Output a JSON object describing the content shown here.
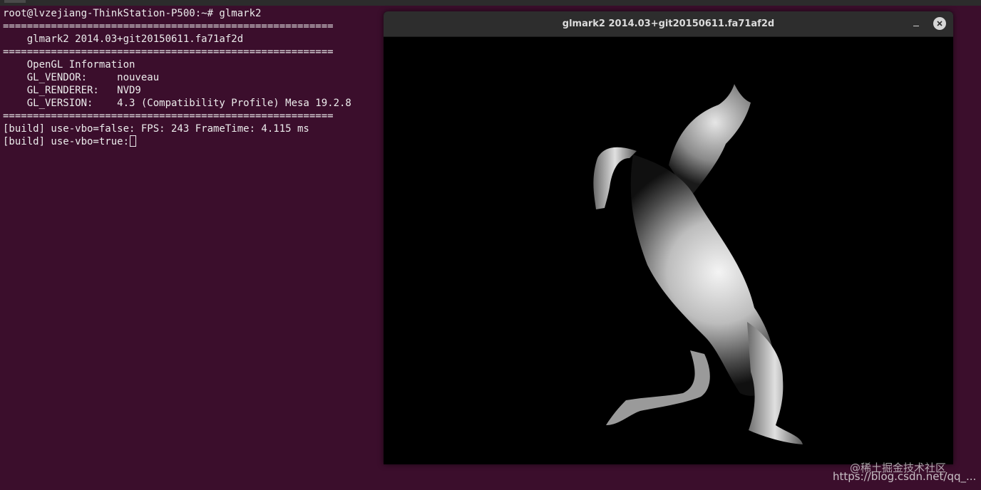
{
  "terminal": {
    "lines": [
      "root@lvzejiang-ThinkStation-P500:~# glmark2",
      "=======================================================",
      "    glmark2 2014.03+git20150611.fa71af2d",
      "=======================================================",
      "    OpenGL Information",
      "    GL_VENDOR:     nouveau",
      "    GL_RENDERER:   NVD9",
      "    GL_VERSION:    4.3 (Compatibility Profile) Mesa 19.2.8",
      "=======================================================",
      "[build] use-vbo=false: FPS: 243 FrameTime: 4.115 ms",
      "[build] use-vbo=true:"
    ]
  },
  "gl_window": {
    "title": "glmark2 2014.03+git20150611.fa71af2d",
    "scene": "horse-model"
  },
  "icons": {
    "minimize": "minimize-icon",
    "close": "close-icon"
  },
  "colors": {
    "terminal_background": "#3b0e2c",
    "terminal_text": "#ececec",
    "gl_background": "#000000",
    "titlebar": "#2d2d2d"
  },
  "watermarks": {
    "juejin": "@稀土掘金技术社区",
    "csdn": "https://blog.csdn.net/qq_..."
  }
}
